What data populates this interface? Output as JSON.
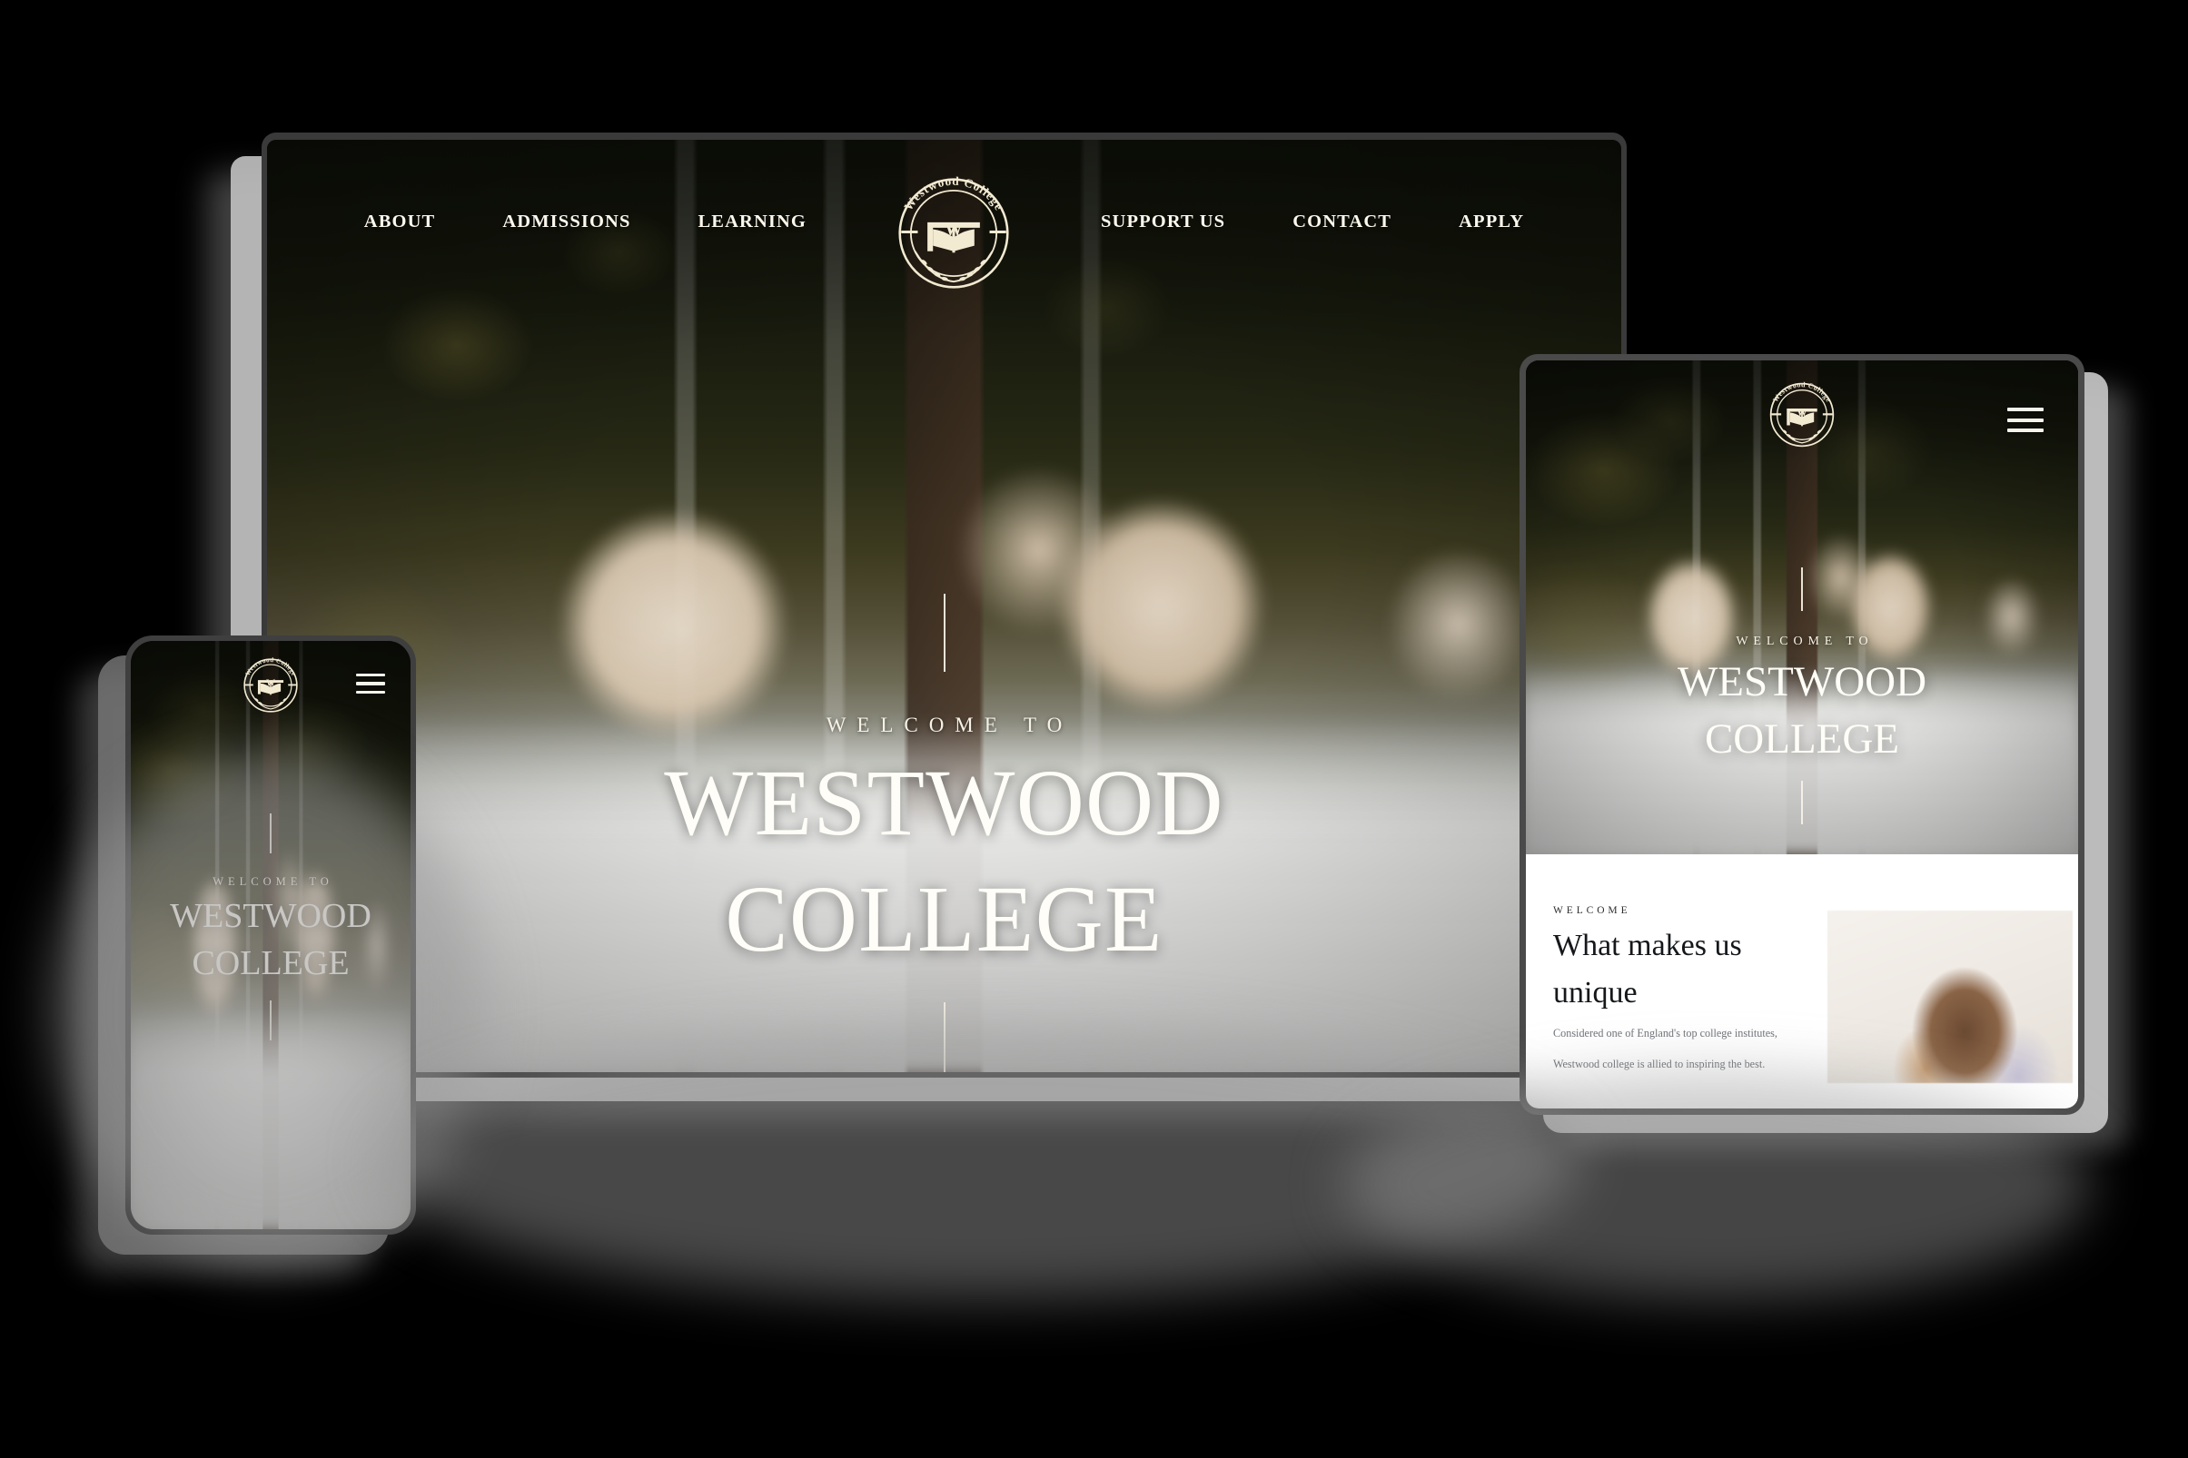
{
  "brand": {
    "name": "Westwood College",
    "emblem_arc_text": "Westwood College",
    "emblem_monogram": "W",
    "logo_icon": "westwood-college-crest-icon",
    "gold": "#f3ead2",
    "cream": "#fffdf7"
  },
  "desktop": {
    "nav_left": [
      {
        "label": "ABOUT"
      },
      {
        "label": "ADMISSIONS"
      },
      {
        "label": "LEARNING"
      }
    ],
    "nav_right": [
      {
        "label": "SUPPORT US"
      },
      {
        "label": "CONTACT"
      },
      {
        "label": "APPLY"
      }
    ],
    "hero": {
      "eyebrow": "WELCOME TO",
      "title_line1": "WESTWOOD",
      "title_line2": "COLLEGE"
    }
  },
  "tablet": {
    "menu_icon": "hamburger-menu-icon",
    "hero": {
      "eyebrow": "WELCOME TO",
      "title_line1": "WESTWOOD",
      "title_line2": "COLLEGE"
    },
    "card": {
      "eyebrow": "WELCOME",
      "title_line1": "What makes us",
      "title_line2": "unique",
      "body_line1": "Considered one of England's top college institutes,",
      "body_line2": "Westwood college is allied to inspiring the best.",
      "photo_alt": "smiling-teacher-photo"
    }
  },
  "mobile": {
    "menu_icon": "hamburger-menu-icon",
    "hero": {
      "eyebrow": "WELCOME TO",
      "title_line1": "WESTWOOD",
      "title_line2": "COLLEGE"
    }
  }
}
